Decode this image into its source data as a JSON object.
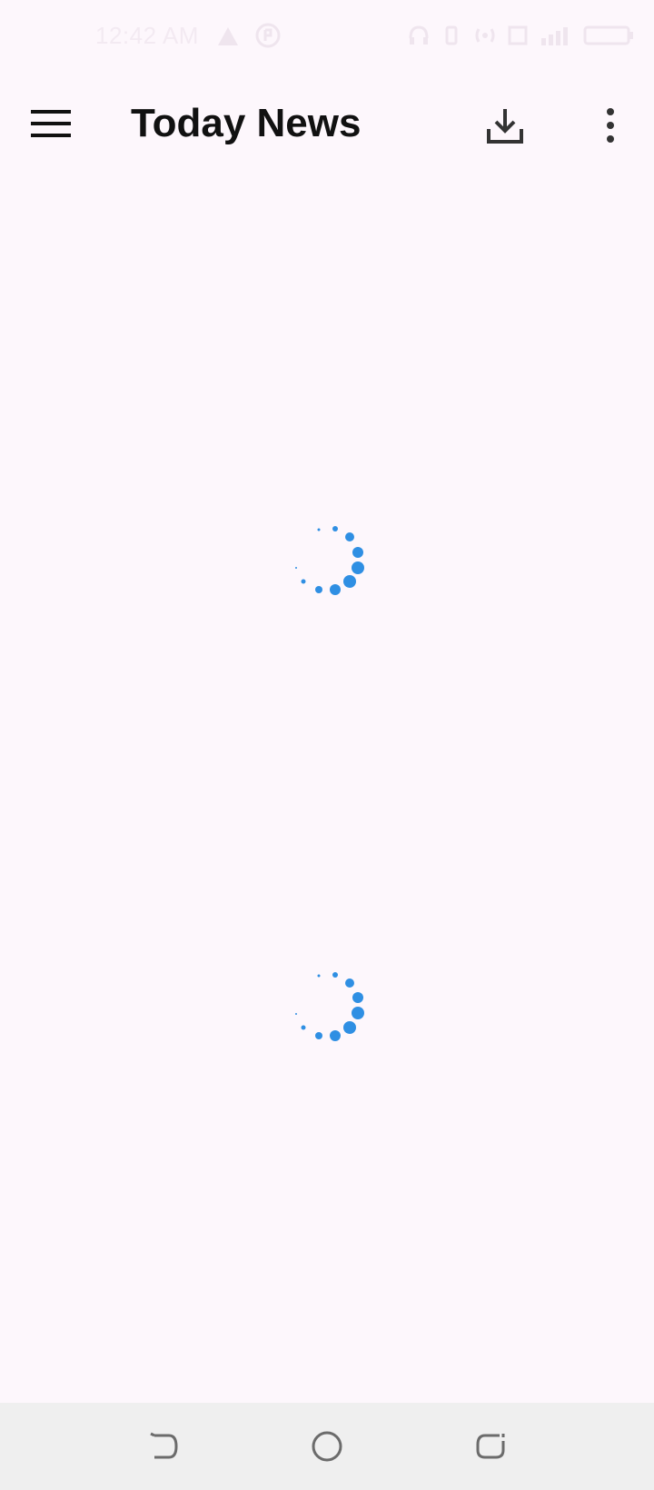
{
  "status_bar": {
    "time": "12:42 AM",
    "icons": [
      "notification-icon",
      "app-icon",
      "headset-icon",
      "vibrate-icon",
      "hotspot-icon",
      "volte-icon",
      "signal-icon",
      "battery-icon"
    ]
  },
  "app_bar": {
    "title": "Today News",
    "icons": {
      "menu": "hamburger-menu-icon",
      "download": "download-icon",
      "more": "more-vertical-icon"
    }
  },
  "content": {
    "loading_indicators": 2,
    "accent_color": "#2f8fe3"
  },
  "nav_bar": {
    "buttons": [
      "back",
      "home",
      "recents"
    ]
  },
  "colors": {
    "background": "#fdf7fc",
    "title_text": "#111111",
    "nav_background": "#efefef",
    "nav_icon": "#6b6b6b"
  }
}
